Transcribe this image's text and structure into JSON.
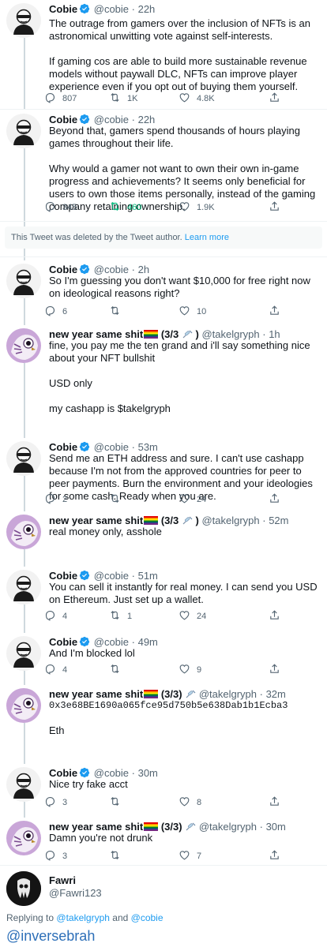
{
  "tweets": [
    {
      "name": "Cobie",
      "verified": true,
      "handle": "@cobie",
      "time": "22h",
      "paragraphs": [
        "The outrage from gamers over the inclusion of NFTs is an astronomical unwitting vote against self-interests.",
        "If gaming cos are able to build more sustainable revenue models without paywall DLC, NFTs can improve player experience even if you opt out of buying them yourself."
      ],
      "replies": "807",
      "retweets": "1K",
      "likes": "4.8K",
      "avatar": "cobie"
    },
    {
      "name": "Cobie",
      "verified": true,
      "handle": "@cobie",
      "time": "22h",
      "paragraphs": [
        "Beyond that, gamers spend thousands of hours playing games throughout their life.",
        "Why would a gamer not want to own their own in-game progress and achievements? It seems only beneficial for users to own those items personally, instead of the gaming company retaining ownership."
      ],
      "replies": "345",
      "retweets": "460",
      "likes": "1.9K",
      "avatar": "cobie",
      "retweeted": true
    },
    {
      "name": "Cobie",
      "verified": true,
      "handle": "@cobie",
      "time": "2h",
      "paragraphs": [
        "So I'm guessing you don't want $10,000 for free right now on ideological reasons right?"
      ],
      "replies": "6",
      "retweets": "",
      "likes": "10",
      "avatar": "cobie"
    },
    {
      "name": "new year same shit",
      "suffix": " (3/3 ",
      "suffix_end": " )",
      "handle": "@takelgryph",
      "time": "1h",
      "paragraphs": [
        "fine, you pay me the ten grand and i'll say something nice about your NFT bullshit",
        "USD only",
        "my cashapp is $takelgryph"
      ],
      "replies": "",
      "retweets": "",
      "likes": "",
      "avatar": "owl"
    },
    {
      "name": "Cobie",
      "verified": true,
      "handle": "@cobie",
      "time": "53m",
      "paragraphs": [
        "Send me an ETH address and sure. I can't use cashapp because I'm not from the approved countries for peer to peer payments. Burn the environment and your ideologies for some cash. Ready when you are."
      ],
      "replies": "2",
      "retweets": "",
      "likes": "24",
      "avatar": "cobie"
    },
    {
      "name": "new year same shit",
      "suffix": " (3/3 ",
      "suffix_end": " )",
      "handle": "@takelgryph",
      "time": "52m",
      "paragraphs": [
        "real money only, asshole"
      ],
      "replies": "",
      "retweets": "",
      "likes": "",
      "avatar": "owl"
    },
    {
      "name": "Cobie",
      "verified": true,
      "handle": "@cobie",
      "time": "51m",
      "paragraphs": [
        "You can sell it instantly for real money. I can send you USD on Ethereum. Just set up a wallet."
      ],
      "replies": "4",
      "retweets": "1",
      "likes": "24",
      "avatar": "cobie"
    },
    {
      "name": "Cobie",
      "verified": true,
      "handle": "@cobie",
      "time": "49m",
      "paragraphs": [
        "And I'm blocked lol"
      ],
      "replies": "4",
      "retweets": "",
      "likes": "9",
      "avatar": "cobie"
    },
    {
      "name": "new year same shit",
      "suffix": " (3/3) ",
      "suffix_end": "",
      "handle": "@takelgryph",
      "time": "32m",
      "paragraphs": [
        "0x3e68BE1690a065fce95d750b5e638Dab1b1Ecba3",
        "Eth"
      ],
      "replies": "",
      "retweets": "",
      "likes": "",
      "avatar": "owl",
      "mono_first": true
    },
    {
      "name": "Cobie",
      "verified": true,
      "handle": "@cobie",
      "time": "30m",
      "paragraphs": [
        "Nice try fake acct"
      ],
      "replies": "3",
      "retweets": "",
      "likes": "8",
      "avatar": "cobie"
    },
    {
      "name": "new year same shit",
      "suffix": " (3/3) ",
      "suffix_end": "",
      "handle": "@takelgryph",
      "time": "30m",
      "paragraphs": [
        "Damn you're not drunk"
      ],
      "replies": "3",
      "retweets": "",
      "likes": "7",
      "avatar": "owl"
    }
  ],
  "deleted_notice": {
    "text": "This Tweet was deleted by the Tweet author.",
    "link": "Learn more"
  },
  "footer_user": {
    "name": "Fawri",
    "handle": "@Fawri123"
  },
  "replying": {
    "prefix": "Replying to",
    "user1": "@takelgryph",
    "and": "and",
    "user2": "@cobie"
  },
  "watermark": "@inversebrah",
  "colors": {
    "accent": "#1d9bf0",
    "retweet_green": "#00ba7c",
    "text_secondary": "#536471"
  }
}
